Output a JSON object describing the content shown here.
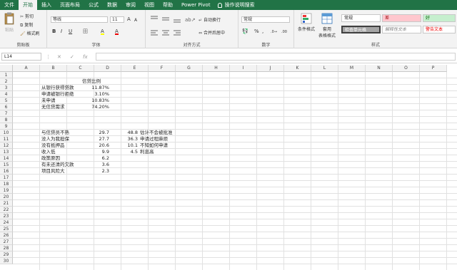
{
  "tabs": [
    "文件",
    "开始",
    "插入",
    "页面布局",
    "公式",
    "数据",
    "审阅",
    "视图",
    "帮助",
    "Power Pivot"
  ],
  "active_tab": "开始",
  "tell_me": "操作说明搜索",
  "ribbon": {
    "clipboard": {
      "paste": "粘贴",
      "cut": "剪切",
      "copy": "复制",
      "format_painter": "格式刷",
      "label": "剪贴板"
    },
    "font": {
      "name": "等线",
      "size": "11",
      "grow": "A",
      "shrink": "A",
      "bold": "B",
      "italic": "I",
      "underline": "U",
      "border": "田",
      "fill": "A",
      "color": "A",
      "label": "字体"
    },
    "align": {
      "wrap": "自动换行",
      "merge": "合并后居中",
      "label": "对齐方式"
    },
    "number": {
      "format": "常规",
      "pct": "%",
      "comma": ",",
      "label": "数字"
    },
    "styles": {
      "cond": "条件格式",
      "table": "套用",
      "table2": "表格格式",
      "normal": "常规",
      "bad": "差",
      "good": "好",
      "check": "检查单元格",
      "explain": "解释性文本",
      "warn": "警告文本",
      "label": "样式"
    }
  },
  "name_box": "L14",
  "formula_bar": {
    "cancel": "✕",
    "confirm": "✓",
    "fx": "fx",
    "value": ""
  },
  "columns": [
    "A",
    "B",
    "C",
    "D",
    "E",
    "F",
    "G",
    "H",
    "I",
    "J",
    "K",
    "L",
    "M",
    "N",
    "O",
    "P"
  ],
  "rows": [
    "1",
    "2",
    "3",
    "4",
    "5",
    "6",
    "7",
    "8",
    "9",
    "10",
    "11",
    "12",
    "13",
    "14",
    "15",
    "16",
    "17",
    "18",
    "19",
    "20",
    "21",
    "22",
    "23",
    "24",
    "25",
    "26",
    "27",
    "28",
    "29",
    "30"
  ],
  "colors": {
    "brand": "#217346",
    "bad_fill": "#ffc7ce",
    "good_fill": "#c6efce",
    "check_fill": "#a5a5a5"
  },
  "cells": {
    "c2": "信贷比例",
    "b3": "从银行获得贷款",
    "c3": "11.87%",
    "b4": "申请被银行拒绝",
    "c4": "3.10%",
    "b5": "未申请",
    "c5": "10.83%",
    "b6": "无信贷需求",
    "c6": "74.20%",
    "b10": "与信贷员不熟",
    "c10": "29.7",
    "d10": "48.8",
    "e10": "估计不会被批准",
    "b11": "没人为我担保",
    "c11": "27.7",
    "d11": "36.3",
    "e11": "申请过程麻烦",
    "b12": "没有抵押品",
    "c12": "20.6",
    "d12": "10.1",
    "e12": "不知如何申请",
    "b13": "收入低",
    "c13": "9.9",
    "d13": "4.5",
    "e13": "利息高",
    "b14": "政策原因",
    "c14": "6.2",
    "b15": "有未还清的欠款",
    "c15": "3.6",
    "b16": "项目风险大",
    "c16": "2.3"
  }
}
